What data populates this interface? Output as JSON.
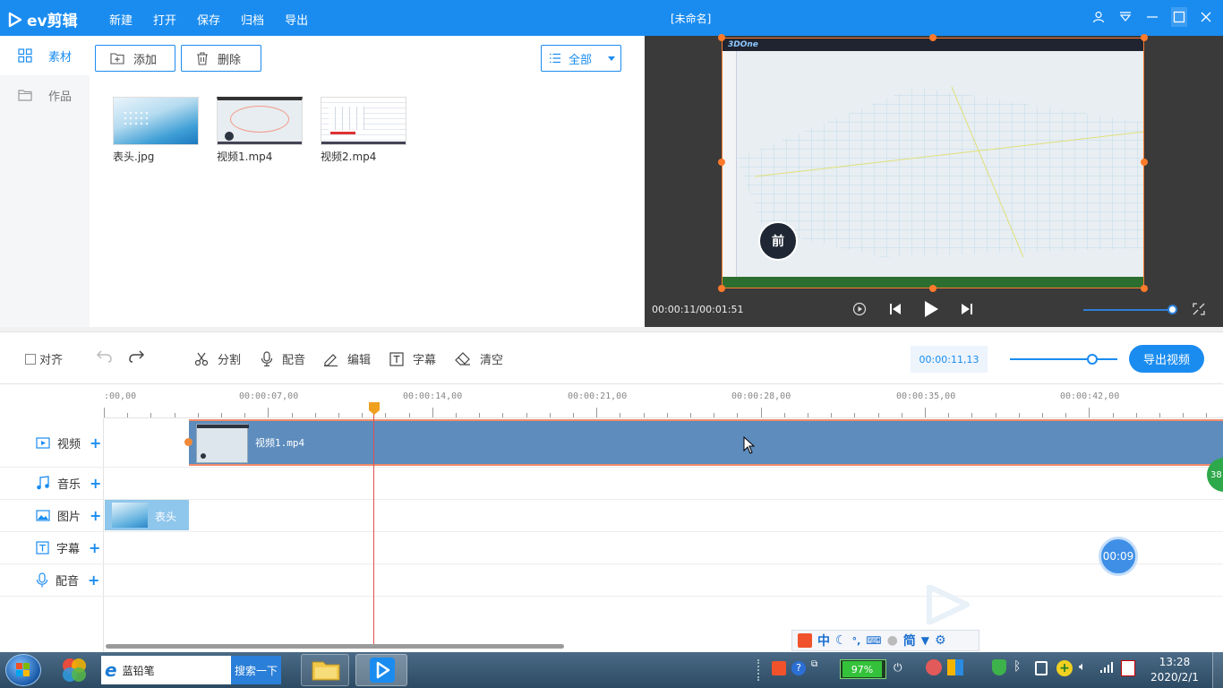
{
  "app": {
    "logo_text": "ev剪辑",
    "menu": [
      "新建",
      "打开",
      "保存",
      "归档",
      "导出"
    ],
    "doc_title": "[未命名]"
  },
  "sidebar": {
    "items": [
      {
        "label": "素材",
        "icon": "grid-icon",
        "active": true
      },
      {
        "label": "作品",
        "icon": "folder-icon",
        "active": false
      }
    ]
  },
  "material": {
    "add_label": "添加",
    "delete_label": "删除",
    "filter_label": "全部",
    "files": [
      {
        "name": "表头.jpg"
      },
      {
        "name": "视频1.mp4"
      },
      {
        "name": "视频2.mp4"
      }
    ]
  },
  "preview": {
    "app_in_screen": "3DOne",
    "badge_char": "前",
    "time": "00:00:11/00:01:51",
    "volume": 0.95
  },
  "toolbar": {
    "align_label": "对齐",
    "split_label": "分割",
    "dub_label": "配音",
    "edit_label": "编辑",
    "subtitle_label": "字幕",
    "clear_label": "清空",
    "timecode": "00:00:11,13",
    "zoom": 0.75,
    "export_label": "导出视频"
  },
  "timeline": {
    "ruler_ticks": [
      "00:00:00,00",
      "00:00:07,00",
      "00:00:14,00",
      "00:00:21,00",
      "00:00:28,00",
      "00:00:35,00",
      "00:00:42,00"
    ],
    "ruler_first_visible": ":00,00",
    "tracks": [
      {
        "label": "视频",
        "icon": "video-icon"
      },
      {
        "label": "音乐",
        "icon": "music-icon"
      },
      {
        "label": "图片",
        "icon": "image-icon"
      },
      {
        "label": "字幕",
        "icon": "text-icon"
      },
      {
        "label": "配音",
        "icon": "mic-icon"
      }
    ],
    "video_clip": "视频1.mp4",
    "image_clip": "表头",
    "float_timer": "00:09",
    "side_badge": "38"
  },
  "ime": {
    "items": [
      "中",
      "简"
    ]
  },
  "taskbar": {
    "search_text": "蓝铅笔",
    "search_btn": "搜索一下",
    "battery": "97%",
    "time": "13:28",
    "date": "2020/2/1"
  }
}
